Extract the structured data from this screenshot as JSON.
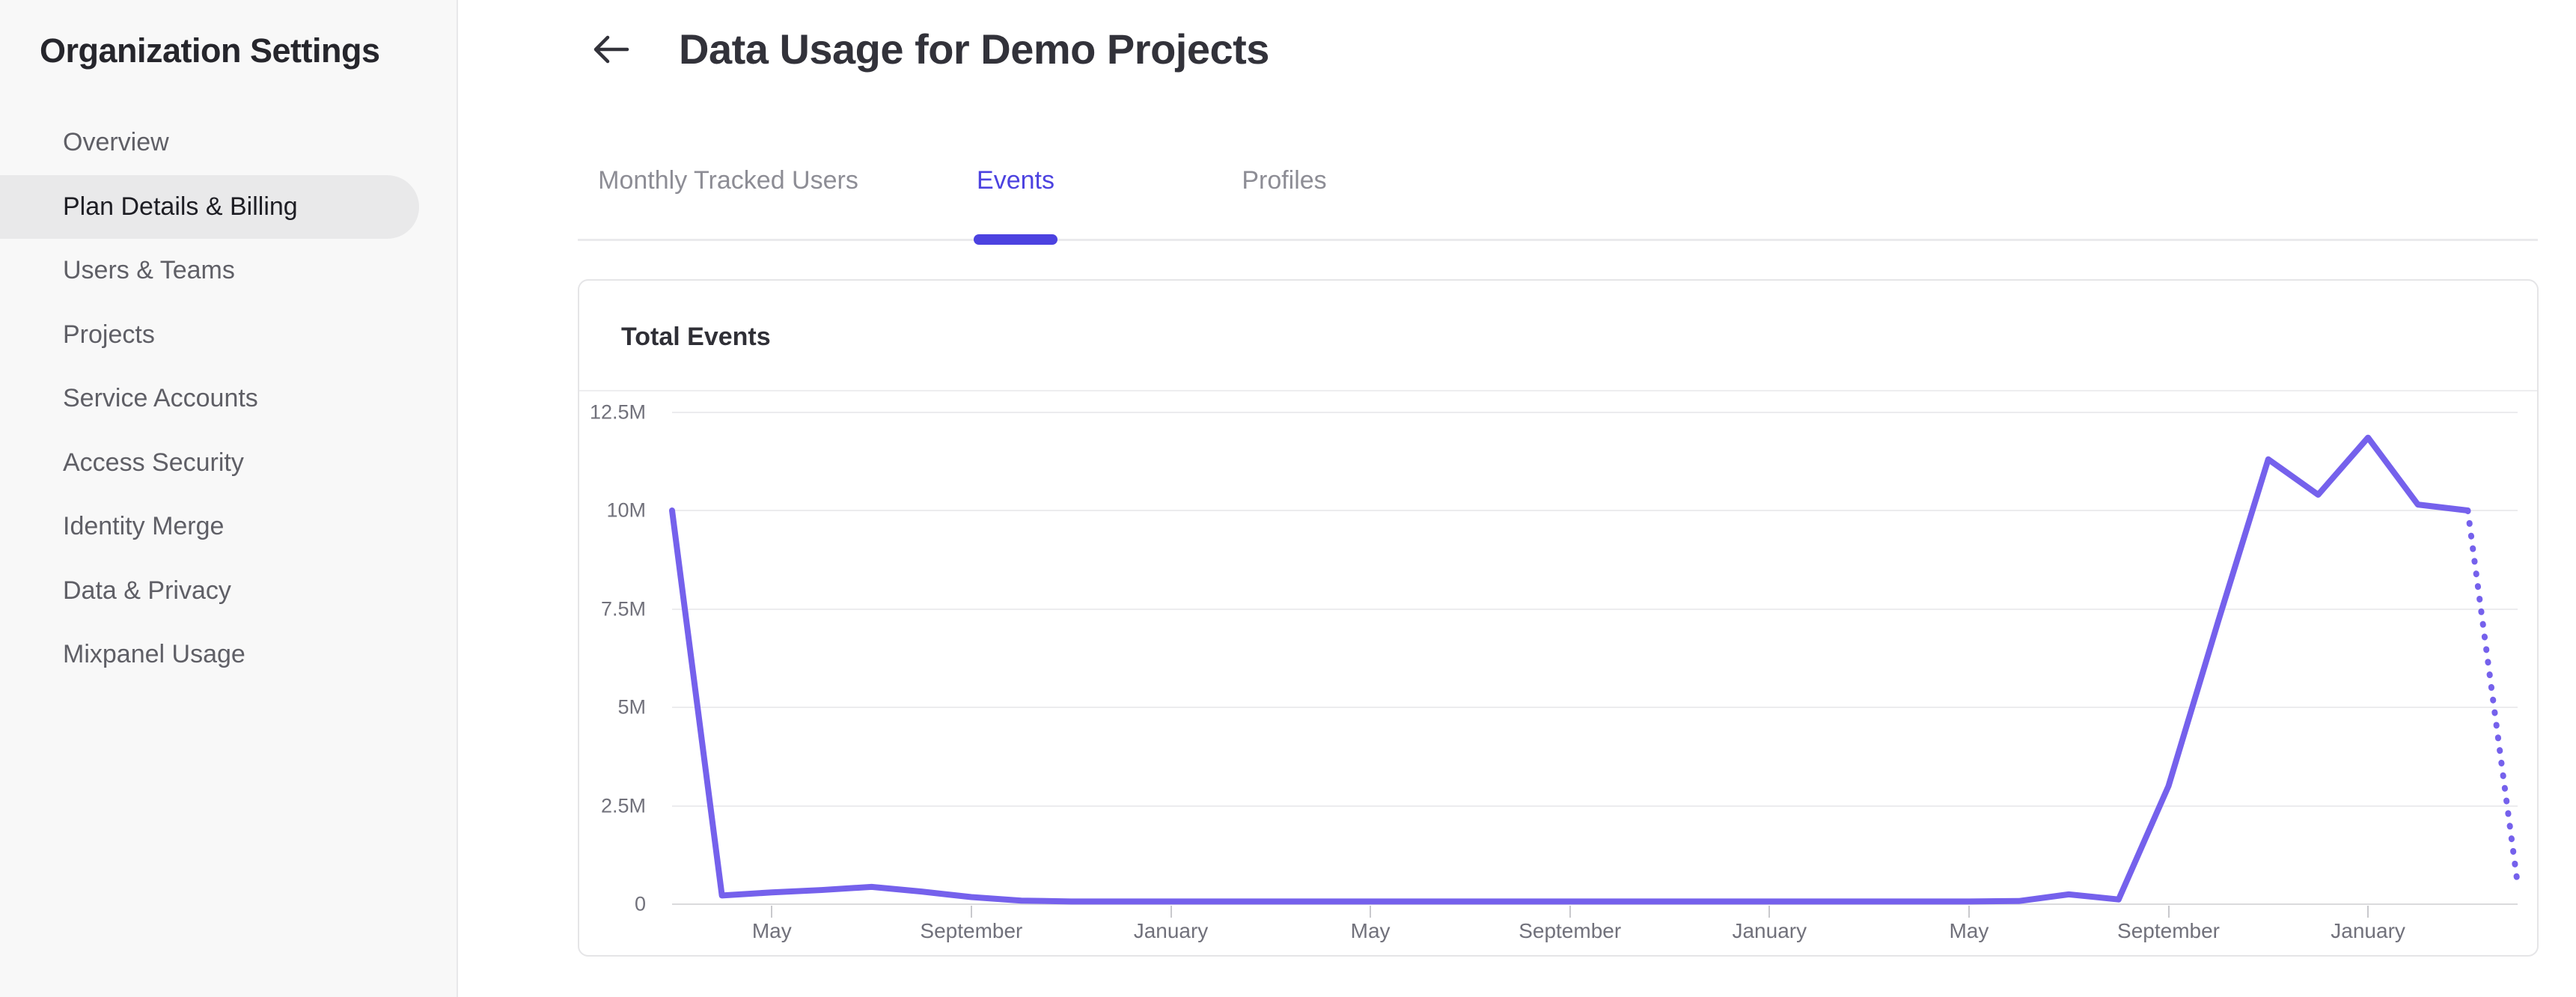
{
  "sidebar": {
    "title": "Organization Settings",
    "items": [
      {
        "label": "Overview",
        "active": false
      },
      {
        "label": "Plan Details & Billing",
        "active": true
      },
      {
        "label": "Users & Teams",
        "active": false
      },
      {
        "label": "Projects",
        "active": false
      },
      {
        "label": "Service Accounts",
        "active": false
      },
      {
        "label": "Access Security",
        "active": false
      },
      {
        "label": "Identity Merge",
        "active": false
      },
      {
        "label": "Data & Privacy",
        "active": false
      },
      {
        "label": "Mixpanel Usage",
        "active": false
      }
    ]
  },
  "header": {
    "title": "Data Usage for Demo Projects",
    "back_icon": "left-arrow"
  },
  "tabs": [
    {
      "label": "Monthly Tracked Users",
      "active": false
    },
    {
      "label": "Events",
      "active": true
    },
    {
      "label": "Profiles",
      "active": false
    }
  ],
  "colors": {
    "accent": "#4c42e0",
    "chart_line": "#7561ec",
    "sidebar_active_bg": "#e9e9ea",
    "gridline": "#ececee",
    "axis_text": "#71717b"
  },
  "chart_data": {
    "type": "line",
    "title": "Total Events",
    "ylabel": "",
    "xlabel": "",
    "unit": "events, millions",
    "ylim": [
      0,
      12.5
    ],
    "grid": "horizontal-only",
    "legend": "none",
    "series_name": "Total Events",
    "values_millions": [
      10.0,
      0.22,
      0.3,
      0.36,
      0.44,
      0.32,
      0.18,
      0.09,
      0.07,
      0.07,
      0.07,
      0.07,
      0.07,
      0.07,
      0.07,
      0.07,
      0.07,
      0.07,
      0.07,
      0.07,
      0.07,
      0.07,
      0.07,
      0.07,
      0.07,
      0.07,
      0.07,
      0.08,
      0.25,
      0.12,
      3.0,
      7.2,
      11.3,
      10.4,
      11.85,
      10.15,
      10.0,
      0.5
    ],
    "solid_until_index": 36,
    "projected_last_segment": true,
    "x_tick_indices": [
      2,
      6,
      10,
      14,
      18,
      22,
      26,
      30,
      34
    ],
    "x_tick_labels": [
      "May",
      "September",
      "January",
      "May",
      "September",
      "January",
      "May",
      "September",
      "January"
    ],
    "y_ticks": [
      {
        "value": 0,
        "label": "0"
      },
      {
        "value": 2.5,
        "label": "2.5M"
      },
      {
        "value": 5,
        "label": "5M"
      },
      {
        "value": 7.5,
        "label": "7.5M"
      },
      {
        "value": 10,
        "label": "10M"
      },
      {
        "value": 12.5,
        "label": "12.5M"
      }
    ]
  }
}
